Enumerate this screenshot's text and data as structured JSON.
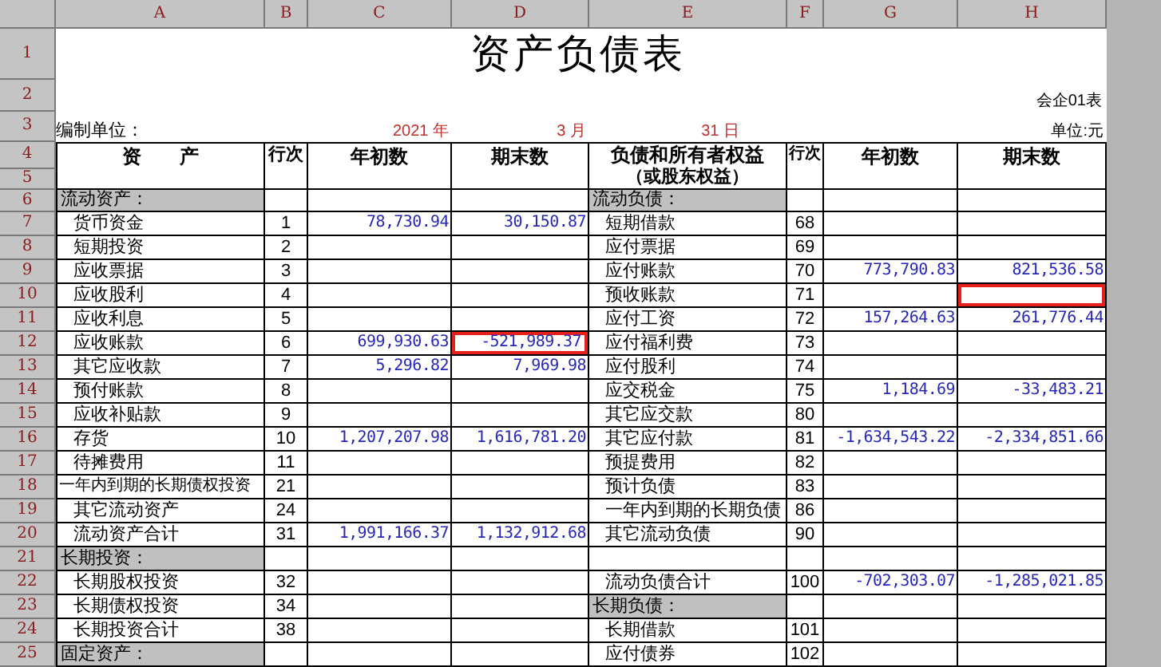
{
  "columns": [
    "A",
    "B",
    "C",
    "D",
    "E",
    "F",
    "G",
    "H"
  ],
  "top_rows": [
    "1",
    "2",
    "3"
  ],
  "title": "资产负债表",
  "form_code": "会企01表",
  "preparer_label": "编制单位：",
  "date": {
    "year": "2021 年",
    "month": "3 月",
    "day": "31 日"
  },
  "unit": "单位:元",
  "header": {
    "rows": [
      "4",
      "5"
    ],
    "left_name": "资　　产",
    "left_line": "行次",
    "left_begin": "年初数",
    "left_end": "期末数",
    "right_name": "负债和所有者权益",
    "right_name_note": "（或股东权益）",
    "right_line": "行次",
    "right_begin": "年初数",
    "right_end": "期末数"
  },
  "rows": [
    {
      "row": "6",
      "left": {
        "kind": "section",
        "name": "流动资产：",
        "end_highlighted": false
      },
      "right": {
        "kind": "section",
        "name": "流动负债：",
        "end_highlighted": false
      }
    },
    {
      "row": "7",
      "left": {
        "kind": "item",
        "indented": true,
        "name": "货币资金",
        "line": "1",
        "begin": "78,730.94",
        "end": "30,150.87",
        "end_highlighted": false
      },
      "right": {
        "kind": "item",
        "indented": true,
        "name": "短期借款",
        "line": "68",
        "end_highlighted": false
      }
    },
    {
      "row": "8",
      "left": {
        "kind": "item",
        "indented": true,
        "name": "短期投资",
        "line": "2",
        "end_highlighted": false
      },
      "right": {
        "kind": "item",
        "indented": true,
        "name": "应付票据",
        "line": "69",
        "end_highlighted": false
      }
    },
    {
      "row": "9",
      "left": {
        "kind": "item",
        "indented": true,
        "name": "应收票据",
        "line": "3",
        "end_highlighted": false
      },
      "right": {
        "kind": "item",
        "indented": true,
        "name": "应付账款",
        "line": "70",
        "begin": "773,790.83",
        "end": "821,536.58",
        "end_highlighted": false
      }
    },
    {
      "row": "10",
      "left": {
        "kind": "item",
        "indented": true,
        "name": "应收股利",
        "line": "4",
        "end_highlighted": false
      },
      "right": {
        "kind": "item",
        "indented": true,
        "name": "预收账款",
        "line": "71",
        "end_highlighted": true
      }
    },
    {
      "row": "11",
      "left": {
        "kind": "item",
        "indented": true,
        "name": "应收利息",
        "line": "5",
        "end_highlighted": false
      },
      "right": {
        "kind": "item",
        "indented": true,
        "name": "应付工资",
        "line": "72",
        "begin": "157,264.63",
        "end": "261,776.44",
        "end_highlighted": false
      }
    },
    {
      "row": "12",
      "left": {
        "kind": "item",
        "indented": true,
        "name": "应收账款",
        "line": "6",
        "begin": "699,930.63",
        "end": "-521,989.37",
        "end_highlighted": true
      },
      "right": {
        "kind": "item",
        "indented": true,
        "name": "应付福利费",
        "line": "73",
        "end_highlighted": false
      }
    },
    {
      "row": "13",
      "left": {
        "kind": "item",
        "indented": true,
        "name": "其它应收款",
        "line": "7",
        "begin": "5,296.82",
        "end": "7,969.98",
        "end_highlighted": false
      },
      "right": {
        "kind": "item",
        "indented": true,
        "name": "应付股利",
        "line": "74",
        "end_highlighted": false
      }
    },
    {
      "row": "14",
      "left": {
        "kind": "item",
        "indented": true,
        "name": "预付账款",
        "line": "8",
        "end_highlighted": false
      },
      "right": {
        "kind": "item",
        "indented": true,
        "name": "应交税金",
        "line": "75",
        "begin": "1,184.69",
        "end": "-33,483.21",
        "end_highlighted": false
      }
    },
    {
      "row": "15",
      "left": {
        "kind": "item",
        "indented": true,
        "name": "应收补贴款",
        "line": "9",
        "end_highlighted": false
      },
      "right": {
        "kind": "item",
        "indented": true,
        "name": "其它应交款",
        "line": "80",
        "end_highlighted": false
      }
    },
    {
      "row": "16",
      "left": {
        "kind": "item",
        "indented": true,
        "name": "存货",
        "line": "10",
        "begin": "1,207,207.98",
        "end": "1,616,781.20",
        "end_highlighted": false
      },
      "right": {
        "kind": "item",
        "indented": true,
        "name": "其它应付款",
        "line": "81",
        "begin": "-1,634,543.22",
        "end": "-2,334,851.66",
        "end_highlighted": false
      }
    },
    {
      "row": "17",
      "left": {
        "kind": "item",
        "indented": true,
        "name": "待摊费用",
        "line": "11",
        "end_highlighted": false
      },
      "right": {
        "kind": "item",
        "indented": true,
        "name": "预提费用",
        "line": "82",
        "end_highlighted": false
      }
    },
    {
      "row": "18",
      "left": {
        "kind": "item",
        "indented": false,
        "name": "一年内到期的长期债权投资",
        "line": "21",
        "end_highlighted": false
      },
      "right": {
        "kind": "item",
        "indented": true,
        "name": "预计负债",
        "line": "83",
        "end_highlighted": false
      }
    },
    {
      "row": "19",
      "left": {
        "kind": "item",
        "indented": true,
        "name": "其它流动资产",
        "line": "24",
        "end_highlighted": false
      },
      "right": {
        "kind": "item",
        "indented": true,
        "name": "一年内到期的长期负债",
        "line": "86",
        "end_highlighted": false
      }
    },
    {
      "row": "20",
      "left": {
        "kind": "item",
        "indented": true,
        "name": "流动资产合计",
        "line": "31",
        "begin": "1,991,166.37",
        "end": "1,132,912.68",
        "end_highlighted": false
      },
      "right": {
        "kind": "item",
        "indented": true,
        "name": "其它流动负债",
        "line": "90",
        "end_highlighted": false
      }
    },
    {
      "row": "21",
      "left": {
        "kind": "section",
        "name": "长期投资：",
        "end_highlighted": false
      },
      "right": {
        "kind": "blank",
        "end_highlighted": false
      }
    },
    {
      "row": "22",
      "left": {
        "kind": "item",
        "indented": true,
        "name": "长期股权投资",
        "line": "32",
        "end_highlighted": false
      },
      "right": {
        "kind": "item",
        "indented": true,
        "name": "流动负债合计",
        "line": "100",
        "begin": "-702,303.07",
        "end": "-1,285,021.85",
        "end_highlighted": false
      }
    },
    {
      "row": "23",
      "left": {
        "kind": "item",
        "indented": true,
        "name": "长期债权投资",
        "line": "34",
        "end_highlighted": false
      },
      "right": {
        "kind": "section",
        "name": "长期负债：",
        "end_highlighted": false
      }
    },
    {
      "row": "24",
      "left": {
        "kind": "item",
        "indented": true,
        "name": "长期投资合计",
        "line": "38",
        "end_highlighted": false
      },
      "right": {
        "kind": "item",
        "indented": true,
        "name": "长期借款",
        "line": "101",
        "end_highlighted": false
      }
    },
    {
      "row": "25",
      "left": {
        "kind": "section",
        "name": "固定资产：",
        "end_highlighted": false
      },
      "right": {
        "kind": "item",
        "indented": true,
        "name": "应付债券",
        "line": "102",
        "end_highlighted": false
      }
    }
  ]
}
